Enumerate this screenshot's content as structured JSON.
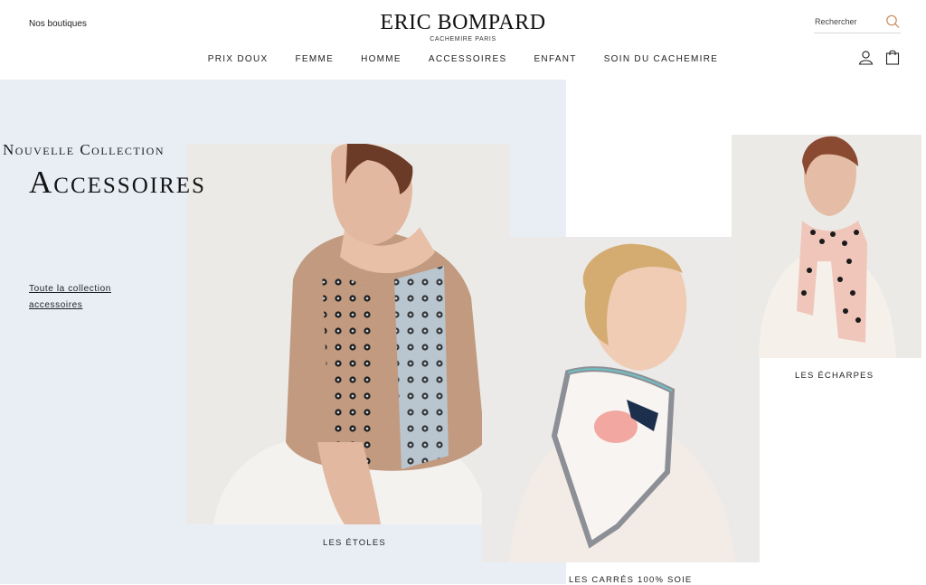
{
  "header": {
    "stores_link": "Nos boutiques",
    "brand": "ERIC BOMPARD",
    "brand_sub": "CACHEMIRE PARIS",
    "search_placeholder": "Rechercher",
    "icons": [
      "search-icon",
      "user-icon",
      "shopping-bag-icon"
    ],
    "accent_color": "#c98a5a"
  },
  "nav": {
    "items": [
      {
        "label": "PRIX DOUX"
      },
      {
        "label": "FEMME"
      },
      {
        "label": "HOMME"
      },
      {
        "label": "ACCESSOIRES"
      },
      {
        "label": "ENFANT"
      },
      {
        "label": "SOIN DU CACHEMIRE"
      }
    ]
  },
  "hero": {
    "kicker": "Nouvelle Collection",
    "title": "Accessoires",
    "link": "Toute la collection accessoires",
    "background": "#e9eef5"
  },
  "tiles": [
    {
      "caption": "LES ÉTOLES"
    },
    {
      "caption": "LES CARRÉS 100% SOIE"
    },
    {
      "caption": "LES ÉCHARPES"
    }
  ]
}
